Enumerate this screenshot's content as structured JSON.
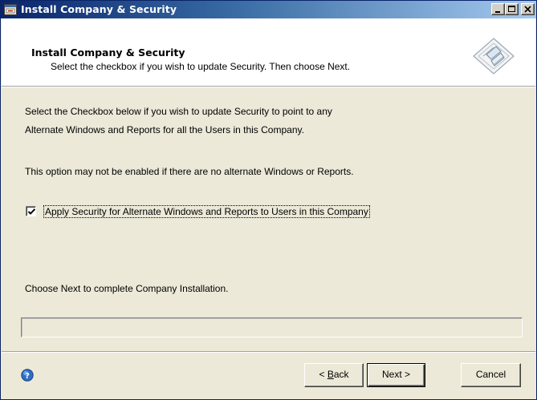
{
  "window": {
    "title": "Install Company & Security",
    "controls": [
      "minimize-icon",
      "maximize-icon",
      "close-icon"
    ]
  },
  "header": {
    "heading": "Install Company & Security",
    "subheading": "Select the checkbox if you wish to update Security.  Then choose Next.",
    "logo_icon": "wizard-diamond-icon"
  },
  "body": {
    "line1": "Select the Checkbox below if you wish to update Security to point to any",
    "line2": "Alternate Windows and Reports for all the Users in this Company.",
    "line3": "This option may not be enabled if there are no alternate Windows or Reports.",
    "checkbox": {
      "label": "Apply Security for Alternate Windows and Reports to Users in this Company",
      "checked": true
    },
    "line4": "Choose Next to complete Company Installation."
  },
  "progress": {
    "value": 0
  },
  "footer": {
    "help_icon": "help-icon",
    "back_prefix": "< ",
    "back_accel": "B",
    "back_rest": "ack",
    "next_label": "Next >",
    "cancel_label": "Cancel"
  },
  "colors": {
    "titlebar_start": "#0A246A",
    "titlebar_end": "#A6CAF0",
    "dialog_bg": "#ECE9D8",
    "header_bg": "#FFFFFF"
  }
}
